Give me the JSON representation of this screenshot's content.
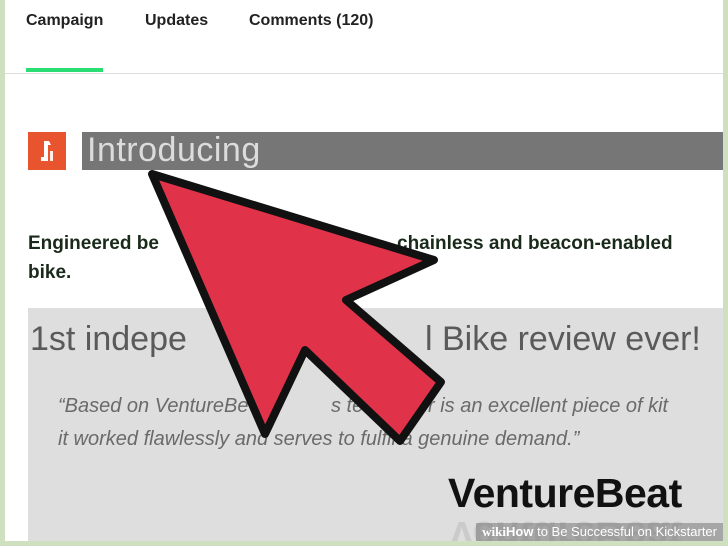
{
  "tabs": {
    "campaign": "Campaign",
    "updates": "Updates",
    "comments": "Comments (120)"
  },
  "intro": {
    "icon": "kickstarter-project-logo",
    "title": "Introducing"
  },
  "engineered": {
    "line1_start": "Engineered be",
    "line1_end": "chainless and beacon-enabled",
    "line2": "bike."
  },
  "review": {
    "title_start": "1st indepe",
    "title_end": "l Bike review ever!",
    "quote_line1_start": "“Based on VentureBe",
    "quote_line1_mid": "s tests, th",
    "quote_line1_end": "r is an excellent piece of kit",
    "quote_line2": "it worked flawlessly and serves to fulfil a genuine demand.”",
    "logo_text": "VentureBeat"
  },
  "watermark": {
    "wiki": "wiki",
    "how": "How",
    "rest": " to Be Successful on Kickstarter"
  },
  "colors": {
    "tab_underline": "#2bde73",
    "logo_orange": "#e8542d",
    "cursor_red": "#e0334a"
  },
  "cursor_icon": "arrow-cursor-icon"
}
